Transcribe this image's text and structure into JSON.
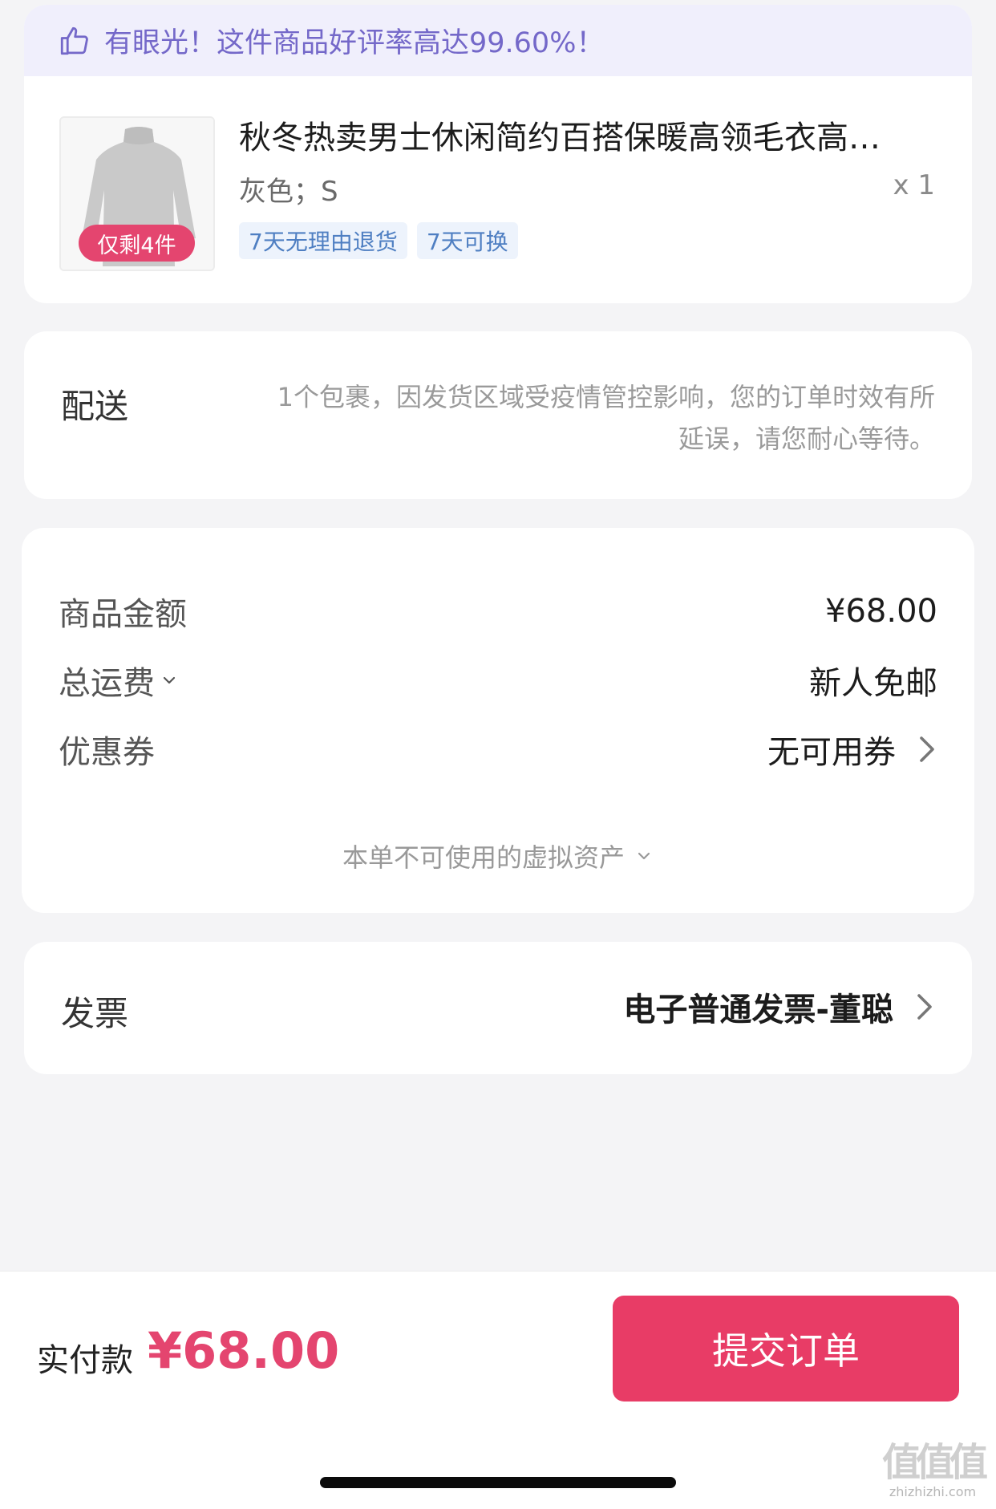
{
  "banner": {
    "icon": "thumbs-up-icon",
    "text": "有眼光！这件商品好评率高达99.60%！"
  },
  "product": {
    "image_icon": "sweater-image",
    "stock_badge": "仅剩4件",
    "title": "秋冬热卖男士休闲简约百搭保暖高领毛衣高…",
    "spec": "灰色；S",
    "quantity": "x 1",
    "tags": [
      "7天无理由退货",
      "7天可换"
    ]
  },
  "delivery": {
    "label": "配送",
    "note_line1": "1个包裹，因发货区域受疫情管控影响，您的订单时效有所",
    "note_line2": "延误，请您耐心等待。"
  },
  "pricing": {
    "goods_amount_label": "商品金额",
    "goods_amount_value": "¥68.00",
    "shipping_label": "总运费",
    "shipping_value": "新人免邮",
    "coupon_label": "优惠券",
    "coupon_value": "无可用券",
    "virtual_assets": "本单不可使用的虚拟资产"
  },
  "invoice": {
    "label": "发票",
    "value": "电子普通发票-董聪"
  },
  "footer": {
    "paid_label": "实付款",
    "paid_amount": "¥68.00",
    "submit_label": "提交订单"
  },
  "watermark": {
    "glyphs": "值值值",
    "text": "zhizhizhi.com"
  },
  "colors": {
    "accent": "#e83c66",
    "banner_bg": "#f0effc",
    "banner_text": "#7468c9",
    "tag_bg": "#edf3fc",
    "tag_text": "#4f7fc2"
  }
}
